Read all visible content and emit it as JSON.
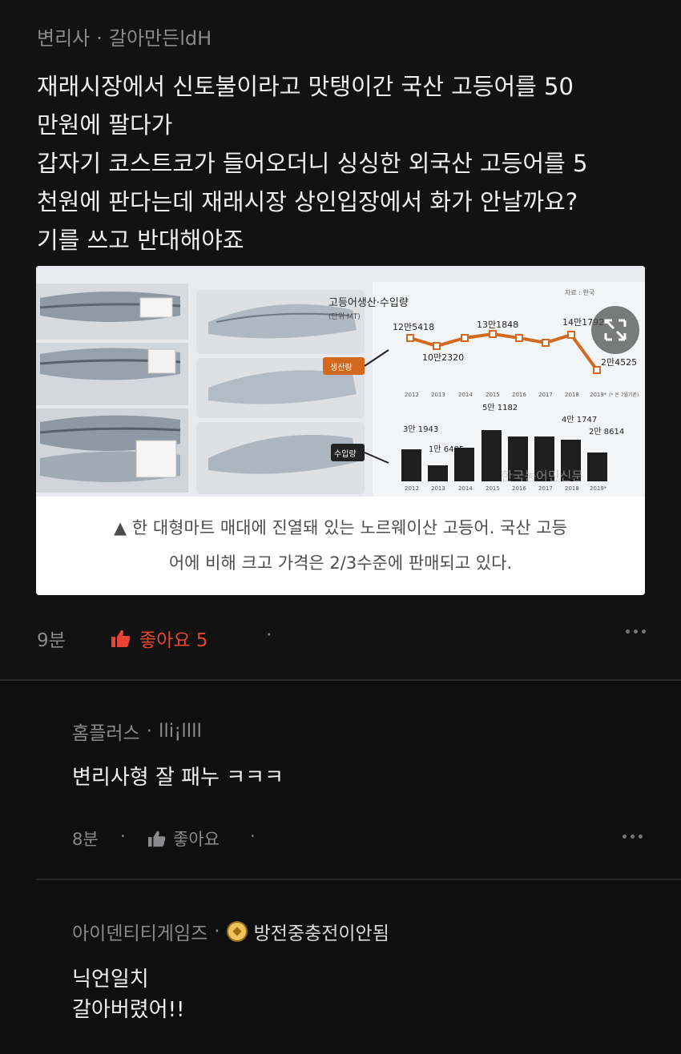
{
  "post": {
    "author": "변리사",
    "separator": "·",
    "nickname": "갈아만든ldH",
    "lines": [
      "재래시장에서 신토불이라고 맛탱이간 국산 고등어를 50",
      "만원에 팔다가",
      "갑자기 코스트코가 들어오더니 싱싱한 외국산 고등어를 5",
      "천원에 판다는데 재래시장 상인입장에서 화가 안날까요?",
      "기를 쓰고 반대해야죠"
    ],
    "time": "9분",
    "like_label": "좋아요 5",
    "like_separator": "·"
  },
  "card": {
    "chart_title": "고등어생산·수입량",
    "chart_unit": "(단위 MT)",
    "production_label": "생산량",
    "import_label": "수입량",
    "production_values": [
      "12만5418",
      "10만2320",
      "13만1848",
      "14만1792",
      "2만4525"
    ],
    "import_values": [
      "3만\n1943",
      "1만\n6485",
      "5만\n1182",
      "4만\n1747",
      "2만\n8614"
    ],
    "years": [
      "2012",
      "2013",
      "2014",
      "2015",
      "2016",
      "2017",
      "2018",
      "2019*"
    ],
    "source_note": "자료 : 한국",
    "footnote": "(* 은 7월기준)",
    "watermark": "한국농어민신문",
    "caption_line1": "▲ 한 대형마트 매대에 진열돼 있는 노르웨이산 고등어. 국산 고등",
    "caption_line2": "어에 비해 크고 가격은 2/3수준에 판매되고 있다."
  },
  "comments": [
    {
      "author": "홈플러스",
      "separator": "·",
      "nickname": "lli¡llll",
      "text": "변리사형 잘 패누 ㅋㅋㅋ",
      "time": "8분",
      "like_label": "좋아요",
      "sep": "·"
    },
    {
      "author": "아이덴티티게임즈",
      "separator": "·",
      "nickname": "방전중충전이안됨",
      "text_line1": "닉언일치",
      "text_line2": "갈아버렸어!!"
    }
  ],
  "chart_data": {
    "type": "bar",
    "title": "고등어생산·수입량",
    "categories": [
      "2012",
      "2013",
      "2014",
      "2015",
      "2016",
      "2017",
      "2018",
      "2019*"
    ],
    "series": [
      {
        "name": "생산량",
        "values": [
          125418,
          102320,
          120000,
          131848,
          131000,
          115000,
          141792,
          24525
        ]
      },
      {
        "name": "수입량",
        "values": [
          31943,
          16485,
          33000,
          51182,
          45000,
          45000,
          41747,
          28614
        ]
      }
    ],
    "ylabel": "MT"
  },
  "colors": {
    "like": "#e9442f",
    "line": "#d2691e"
  }
}
